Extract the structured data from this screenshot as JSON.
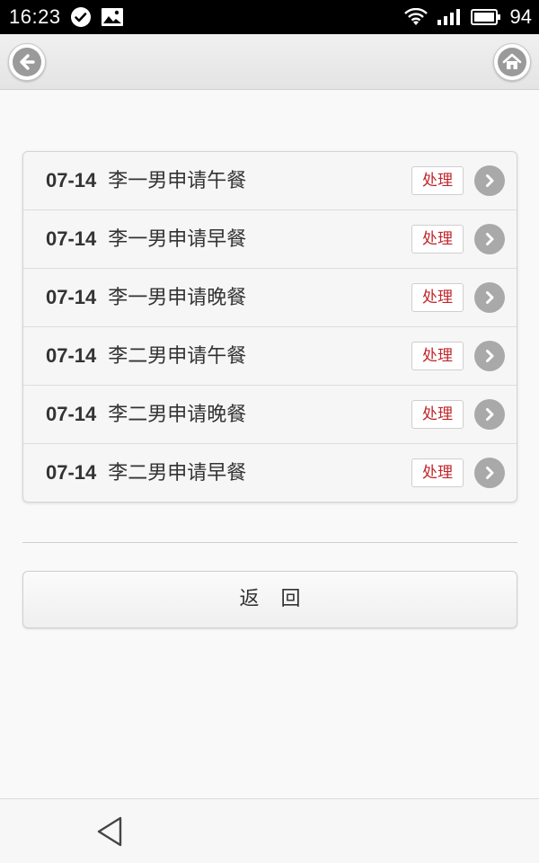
{
  "status_bar": {
    "time": "16:23",
    "battery": "94",
    "icons": [
      "check-circle-icon",
      "image-icon",
      "wifi-icon",
      "signal-icon",
      "battery-icon"
    ]
  },
  "header": {
    "back_icon": "arrow-left-icon",
    "home_icon": "home-icon"
  },
  "requests": [
    {
      "date": "07-14",
      "text": "李一男申请午餐",
      "action": "处理"
    },
    {
      "date": "07-14",
      "text": "李一男申请早餐",
      "action": "处理"
    },
    {
      "date": "07-14",
      "text": "李一男申请晚餐",
      "action": "处理"
    },
    {
      "date": "07-14",
      "text": "李二男申请午餐",
      "action": "处理"
    },
    {
      "date": "07-14",
      "text": "李二男申请晚餐",
      "action": "处理"
    },
    {
      "date": "07-14",
      "text": "李二男申请早餐",
      "action": "处理"
    }
  ],
  "return_button": {
    "label": "返回"
  },
  "colors": {
    "action_text": "#c0262b",
    "chevron": "#a9a9a9"
  }
}
